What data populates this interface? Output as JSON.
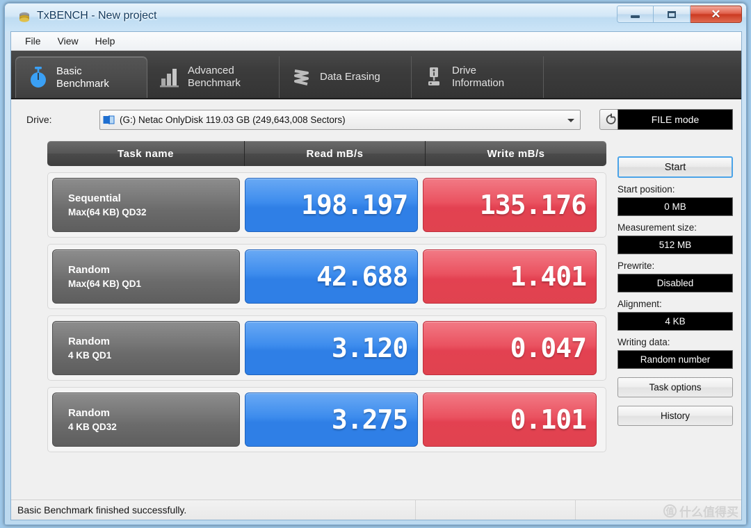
{
  "window": {
    "title": "TxBENCH - New project",
    "icon": "app-icon",
    "controls": {
      "minimize": "minimize",
      "maximize": "maximize",
      "close": "close"
    }
  },
  "menu": {
    "items": [
      "File",
      "View",
      "Help"
    ]
  },
  "tabs": [
    {
      "label": "Basic\nBenchmark",
      "icon": "stopwatch-icon",
      "active": true,
      "name": "tab-basic-benchmark"
    },
    {
      "label": "Advanced\nBenchmark",
      "icon": "bar-chart-icon",
      "active": false,
      "name": "tab-advanced-benchmark"
    },
    {
      "label": "Data Erasing",
      "icon": "eraser-icon",
      "active": false,
      "name": "tab-data-erasing"
    },
    {
      "label": "Drive\nInformation",
      "icon": "drive-info-icon",
      "active": false,
      "name": "tab-drive-information"
    }
  ],
  "drive": {
    "label": "Drive:",
    "selected": "(G:) Netac OnlyDisk  119.03 GB (249,643,008 Sectors)",
    "icon": "drive-icon",
    "refresh_icon": "refresh-icon"
  },
  "table": {
    "headers": [
      "Task name",
      "Read mB/s",
      "Write mB/s"
    ],
    "rows": [
      {
        "task_line1": "Sequential",
        "task_line2": "Max(64 KB) QD32",
        "read": "198.197",
        "write": "135.176"
      },
      {
        "task_line1": "Random",
        "task_line2": "Max(64 KB) QD1",
        "read": "42.688",
        "write": "1.401"
      },
      {
        "task_line1": "Random",
        "task_line2": "4 KB QD1",
        "read": "3.120",
        "write": "0.047"
      },
      {
        "task_line1": "Random",
        "task_line2": "4 KB QD32",
        "read": "3.275",
        "write": "0.101"
      }
    ]
  },
  "side": {
    "mode": "FILE mode",
    "start_button": "Start",
    "start_position_label": "Start position:",
    "start_position_value": "0 MB",
    "measurement_size_label": "Measurement size:",
    "measurement_size_value": "512 MB",
    "prewrite_label": "Prewrite:",
    "prewrite_value": "Disabled",
    "alignment_label": "Alignment:",
    "alignment_value": "4 KB",
    "writing_data_label": "Writing data:",
    "writing_data_value": "Random number",
    "task_options_button": "Task options",
    "history_button": "History"
  },
  "status": {
    "message": "Basic Benchmark finished successfully.",
    "watermark_mark": "值",
    "watermark_text": "什么值得买"
  },
  "colors": {
    "read_blue": "#2f7fe6",
    "write_red": "#e34151",
    "tab_dark": "#3c3c3c",
    "accent_focus": "#4aa3e8"
  }
}
